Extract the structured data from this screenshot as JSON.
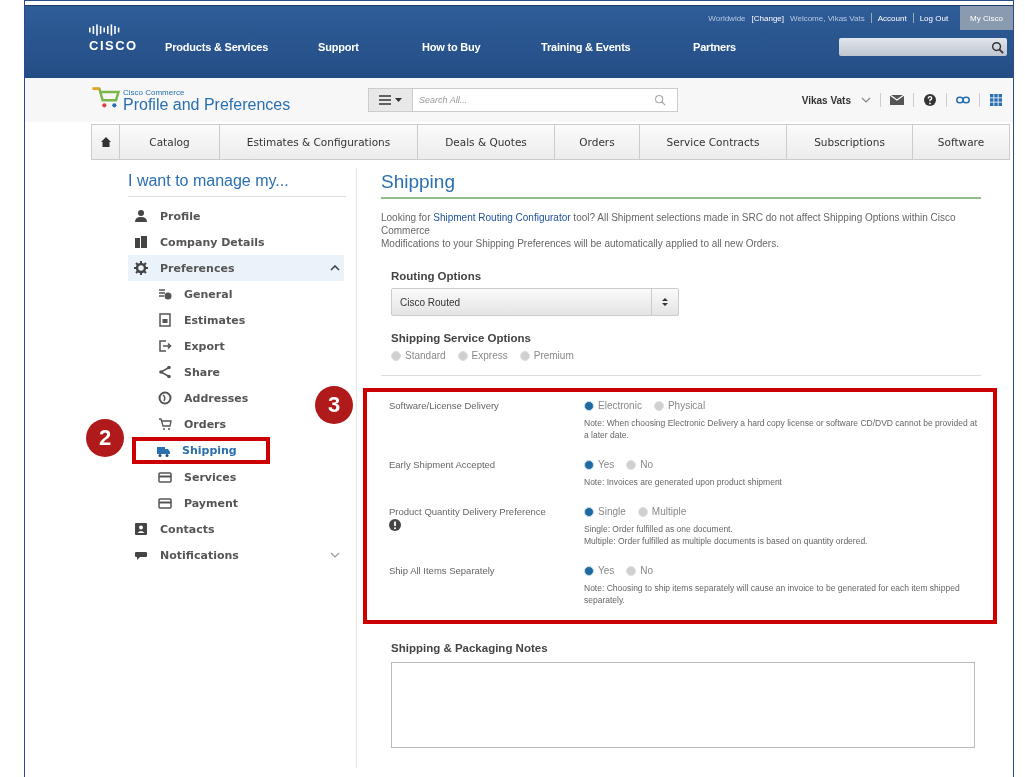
{
  "top_links": {
    "region": "Worldwide",
    "change": "[Change]",
    "welcome": "Welcome, Vikas Vats",
    "account": "Account",
    "logout": "Log Out",
    "my_cisco": "My Cisco"
  },
  "logo": {
    "text": "CISCO"
  },
  "main_nav": [
    "Products & Services",
    "Support",
    "How to Buy",
    "Training & Events",
    "Partners"
  ],
  "app_header": {
    "subtitle": "Cisco Commerce",
    "title": "Profile and Preferences",
    "search_placeholder": "Search All...",
    "user": "Vikas Vats"
  },
  "tabs": [
    {
      "label": "Catalog",
      "selected": false
    },
    {
      "label": "Estimates & Configurations",
      "selected": false
    },
    {
      "label": "Deals & Quotes",
      "selected": false
    },
    {
      "label": "Orders",
      "selected": false
    },
    {
      "label": "Service Contracts",
      "selected": false
    },
    {
      "label": "Subscriptions",
      "selected": false
    },
    {
      "label": "Software",
      "selected": false
    }
  ],
  "sidebar": {
    "heading": "I want to manage my...",
    "items": [
      {
        "label": "Profile",
        "selected": false
      },
      {
        "label": "Company Details",
        "selected": false
      },
      {
        "label": "Preferences",
        "selected": false,
        "expanded": true,
        "children": [
          {
            "label": "General",
            "selected": false
          },
          {
            "label": "Estimates",
            "selected": false
          },
          {
            "label": "Export",
            "selected": false
          },
          {
            "label": "Share",
            "selected": false
          },
          {
            "label": "Addresses",
            "selected": false
          },
          {
            "label": "Orders",
            "selected": false
          },
          {
            "label": "Shipping",
            "selected": true
          },
          {
            "label": "Services",
            "selected": false
          },
          {
            "label": "Payment",
            "selected": false
          }
        ]
      },
      {
        "label": "Contacts",
        "selected": false
      },
      {
        "label": "Notifications",
        "selected": false,
        "expanded": false
      }
    ]
  },
  "page": {
    "title": "Shipping",
    "intro_before": "Looking for ",
    "intro_link": "Shipment Routing Configurator",
    "intro_after": " tool? All Shipment selections made in SRC do not affect Shipping Options within Cisco Commerce",
    "intro_line2": "Modifications to your Shipping Preferences will be automatically applied to all new Orders.",
    "routing_label": "Routing Options",
    "routing_value": "Cisco Routed",
    "service_label": "Shipping Service Options",
    "service_options": [
      {
        "label": "Standard",
        "selected": false
      },
      {
        "label": "Express",
        "selected": false
      },
      {
        "label": "Premium",
        "selected": false
      }
    ],
    "settings": [
      {
        "label": "Software/License Delivery",
        "info": false,
        "options": [
          {
            "label": "Electronic",
            "selected": true
          },
          {
            "label": "Physical",
            "selected": false
          }
        ],
        "notes": [
          "Note: When choosing Electronic Delivery a hard copy license or software CD/DVD cannot be provided at a later date."
        ]
      },
      {
        "label": "Early Shipment Accepted",
        "info": false,
        "options": [
          {
            "label": "Yes",
            "selected": true
          },
          {
            "label": "No",
            "selected": false
          }
        ],
        "notes": [
          "Note: Invoices are generated upon product shipment"
        ]
      },
      {
        "label": "Product Quantity Delivery Preference",
        "info": true,
        "options": [
          {
            "label": "Single",
            "selected": true
          },
          {
            "label": "Multiple",
            "selected": false
          }
        ],
        "notes": [
          "Single: Order fulfilled as one document.",
          "Multiple: Order fulfilled as multiple documents is based on quantity ordered."
        ]
      },
      {
        "label": "Ship All Items Separately",
        "info": false,
        "options": [
          {
            "label": "Yes",
            "selected": true
          },
          {
            "label": "No",
            "selected": false
          }
        ],
        "notes": [
          "Note: Choosing to ship items separately will cause an invoice to be generated for each item shipped separately."
        ]
      }
    ],
    "notes_label": "Shipping & Packaging Notes"
  },
  "callouts": [
    "2",
    "3"
  ]
}
